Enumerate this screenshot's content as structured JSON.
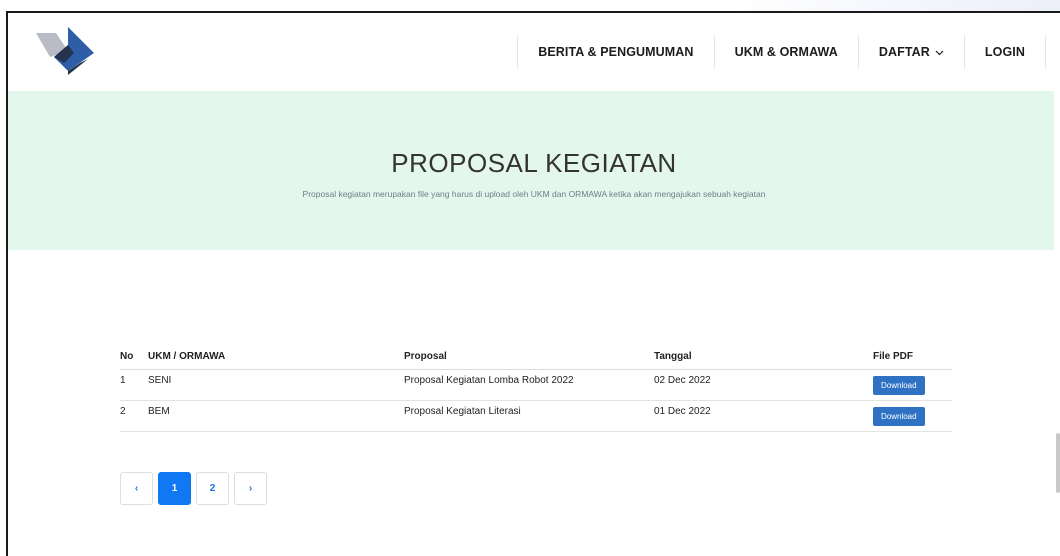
{
  "nav": {
    "items": [
      {
        "label": "BERITA & PENGUMUMAN"
      },
      {
        "label": "UKM & ORMAWA"
      },
      {
        "label": "DAFTAR"
      },
      {
        "label": "LOGIN"
      }
    ]
  },
  "hero": {
    "title": "PROPOSAL KEGIATAN",
    "subtitle": "Proposal kegiatan merupakan file yang harus di upload oleh UKM dan ORMAWA ketika akan mengajukan sebuah kegiatan"
  },
  "table": {
    "headers": {
      "no": "No",
      "ukm": "UKM / ORMAWA",
      "proposal": "Proposal",
      "tanggal": "Tanggal",
      "file": "File PDF"
    },
    "rows": [
      {
        "no": "1",
        "ukm": "SENI",
        "proposal": "Proposal Kegiatan Lomba Robot 2022",
        "tanggal": "02 Dec 2022",
        "button": "Download"
      },
      {
        "no": "2",
        "ukm": "BEM",
        "proposal": "Proposal Kegiatan Literasi",
        "tanggal": "01 Dec 2022",
        "button": "Download"
      }
    ]
  },
  "pagination": {
    "prev": "‹",
    "pages": [
      "1",
      "2"
    ],
    "next": "›",
    "active": "1"
  },
  "colors": {
    "hero_bg": "#e3f7ec",
    "accent": "#1178f3",
    "download_btn": "#2f72c4",
    "logo_dark": "#24344f",
    "logo_blue": "#2f5ea8",
    "logo_gray": "#b9bcc4"
  },
  "icons": {
    "logo": "logo-diamond-icon",
    "dropdown": "chevron-down-icon"
  }
}
